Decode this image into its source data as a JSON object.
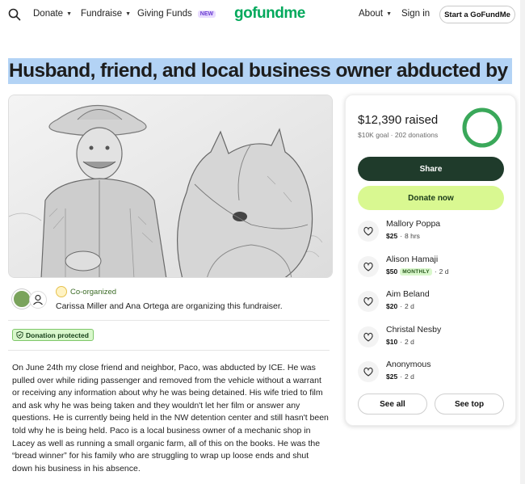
{
  "header": {
    "nav": [
      {
        "label": "Donate",
        "caret": true
      },
      {
        "label": "Fundraise",
        "caret": true
      },
      {
        "label": "Giving Funds",
        "badge": "NEW"
      }
    ],
    "logo": "gofundme",
    "right_nav": [
      {
        "label": "About",
        "caret": true
      },
      {
        "label": "Sign in"
      }
    ],
    "cta": "Start a GoFundMe"
  },
  "title": "Husband, friend, and local business owner abducted by ICE",
  "organizer": {
    "coorganized_label": "Co-organized",
    "text": "Carissa Miller and Ana Ortega are organizing this fundraiser."
  },
  "protected_label": "Donation protected",
  "story": "On June 24th my close friend and neighbor, Paco, was abducted by ICE. He was pulled over while riding passenger and removed from the vehicle without a warrant or receiving any information about why he was being detained. His wife tried to film and ask why he was being taken and they wouldn't let her film or answer any questions. He is currently being held in the NW detention center and still hasn't been told why he is being held. Paco is a local business owner of a mechanic shop in Lacey as well as running a small organic farm, all of this on the books. He was the “bread winner” for his family who are struggling to wrap up loose ends and shut down his business in his absence.",
  "card": {
    "raised_amount": "$12,390",
    "raised_word": "raised",
    "goal": "$10K goal",
    "donations": "202 donations",
    "progress_fraction": 1.0,
    "share_label": "Share",
    "donate_label": "Donate now",
    "donors": [
      {
        "name": "Mallory Poppa",
        "amount": "$25",
        "time": "8 hrs",
        "monthly": ""
      },
      {
        "name": "Alison Hamaji",
        "amount": "$50",
        "time": "2 d",
        "monthly": "MONTHLY"
      },
      {
        "name": "Aim Beland",
        "amount": "$20",
        "time": "2 d",
        "monthly": ""
      },
      {
        "name": "Christal Nesby",
        "amount": "$10",
        "time": "2 d",
        "monthly": ""
      },
      {
        "name": "Anonymous",
        "amount": "$25",
        "time": "2 d",
        "monthly": ""
      }
    ],
    "see_all_label": "See all",
    "see_top_label": "See top"
  },
  "colors": {
    "brand_green": "#02a95c",
    "share_bg": "#1f3b2b",
    "donate_bg": "#d9f891",
    "title_highlight": "#b3d3f5"
  }
}
